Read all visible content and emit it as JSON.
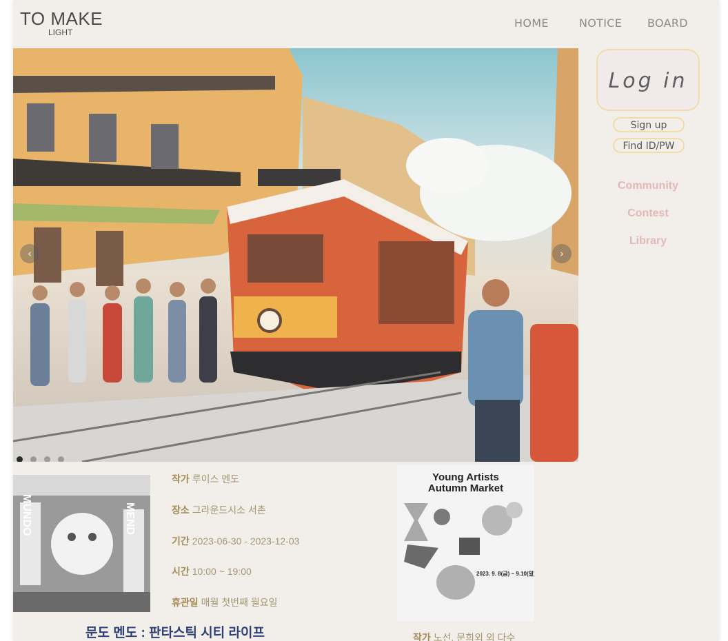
{
  "brand": {
    "name": "TO MAKE",
    "sub": "LIGHT"
  },
  "nav": {
    "items": [
      "HOME",
      "NOTICE",
      "BOARD"
    ]
  },
  "hero": {
    "prev_icon": "chevron-left-icon",
    "next_icon": "chevron-right-icon",
    "slides": 4,
    "active_slide": 1
  },
  "auth": {
    "login": "Log in",
    "signup": "Sign up",
    "find": "Find ID/PW"
  },
  "side_menu": [
    "Community",
    "Contest",
    "Library"
  ],
  "exhibition1": {
    "poster_text": {
      "left": "MUNDO",
      "right": "MEND"
    },
    "info": [
      {
        "label": "작가",
        "value": "루이스 멘도"
      },
      {
        "label": "장소",
        "value": "그라운드시소 서촌"
      },
      {
        "label": "기간",
        "value": "2023-06-30 - 2023-12-03"
      },
      {
        "label": "시간",
        "value": "10:00 ~ 19:00"
      },
      {
        "label": "휴관일",
        "value": "매월 첫번째 월요일"
      }
    ],
    "title": "문도 멘도 : 판타스틱 시티 라이프"
  },
  "exhibition2": {
    "poster_title_1": "Young Artists",
    "poster_title_2": "Autumn Market",
    "poster_date": "2023. 9. 8(금) ~ 9.10(일)",
    "info": {
      "label": "작가",
      "value": "노선, 문희외 외 다수"
    }
  },
  "colors": {
    "page_bg": "#f2eee9",
    "accent_border": "#f2dba6",
    "side_link": "#e3b7b7",
    "title": "#2e3f76"
  }
}
